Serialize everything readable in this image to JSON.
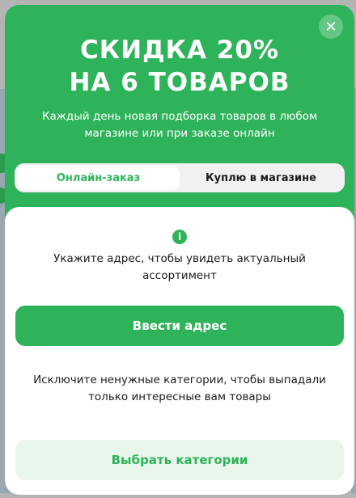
{
  "modal": {
    "close_glyph": "✕",
    "headline_line1": "СКИДКА 20%",
    "headline_line2": "НА 6 ТОВАРОВ",
    "subtext": "Каждый день новая подборка товаров в любом магазине или при заказе онлайн",
    "tabs": [
      {
        "label": "Онлайн-заказ",
        "active": true
      },
      {
        "label": "Куплю в магазине",
        "active": false
      }
    ],
    "info_glyph": "i",
    "address_hint": "Укажите адрес, чтобы увидеть актуальный ассортимент",
    "enter_address_label": "Ввести адрес",
    "category_hint": "Исключите ненужные категории, чтобы выпадали только интересные вам товары",
    "choose_categories_label": "Выбрать категории"
  },
  "colors": {
    "accent": "#2fb35a",
    "tabs_bg": "#f1f1f4",
    "secondary_btn_bg": "#e8f6ec",
    "text": "#1c1c1c"
  }
}
